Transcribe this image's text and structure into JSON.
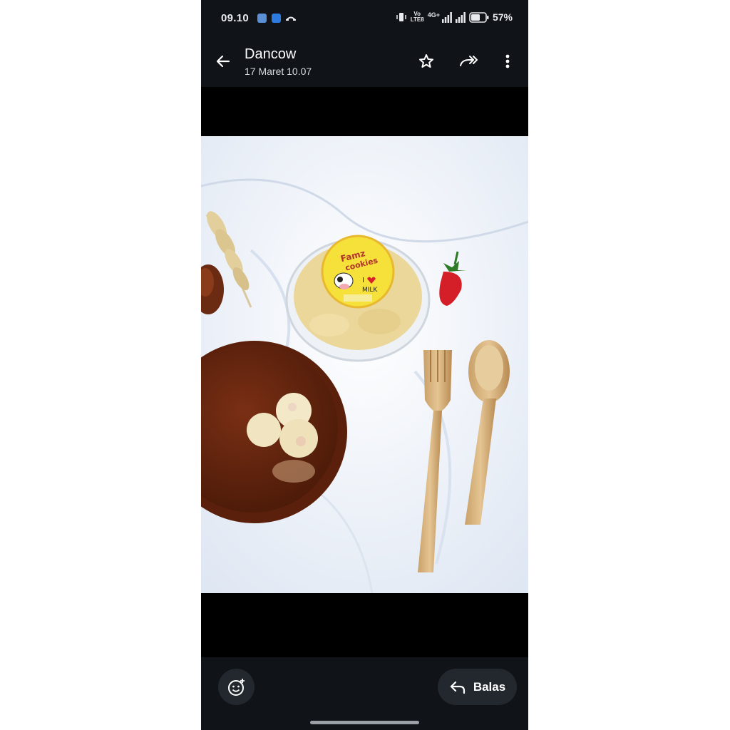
{
  "status_bar": {
    "time": "09.10",
    "network_label_top": "Vo",
    "network_label_bottom": "LTE8",
    "signal_label": "4G+",
    "battery_percent": "57%",
    "icons": [
      "app-d-icon",
      "app-person-icon",
      "missed-call-icon",
      "vibrate-icon",
      "signal-icon",
      "battery-icon"
    ]
  },
  "header": {
    "title": "Dancow",
    "subtitle": "17 Maret 10.07",
    "actions": [
      "star-icon",
      "forward-icon",
      "more-icon"
    ]
  },
  "photo": {
    "label_brand_line1": "Famz",
    "label_brand_line2": "cookies",
    "label_heart_text": "I",
    "label_milk_text": "MILK"
  },
  "footer": {
    "reply_label": "Balas"
  },
  "colors": {
    "bar_bg": "#101418",
    "pill_bg": "#22282d",
    "text": "#ffffff",
    "label_yellow": "#f5e13a"
  }
}
